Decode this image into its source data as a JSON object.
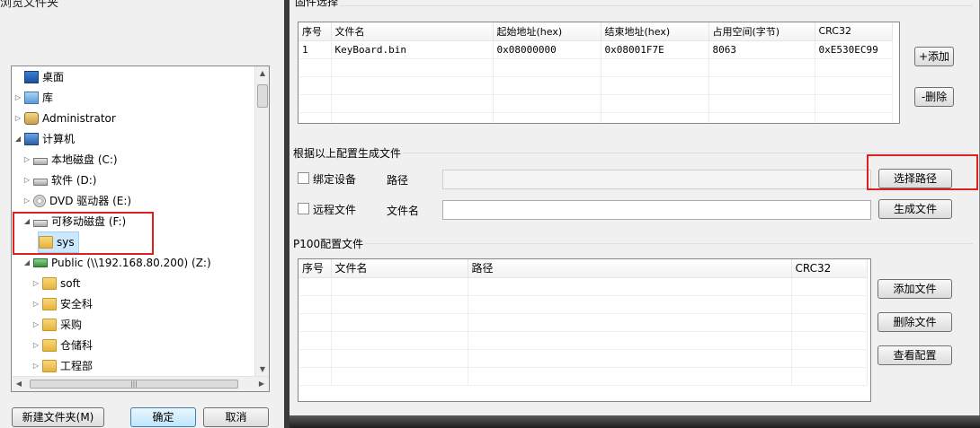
{
  "browse_dialog": {
    "title": "浏览文件夹",
    "tree": [
      {
        "label": "桌面",
        "icon": "desktop-icon"
      },
      {
        "label": "库",
        "icon": "library-icon"
      },
      {
        "label": "Administrator",
        "icon": "user-folder-icon"
      },
      {
        "label": "计算机",
        "icon": "computer-icon"
      },
      {
        "label": "本地磁盘 (C:)",
        "icon": "hard-drive-icon"
      },
      {
        "label": "软件 (D:)",
        "icon": "hard-drive-icon"
      },
      {
        "label": "DVD 驱动器 (E:)",
        "icon": "dvd-drive-icon"
      },
      {
        "label": "可移动磁盘 (F:)",
        "icon": "removable-drive-icon"
      },
      {
        "label": "sys",
        "icon": "folder-icon"
      },
      {
        "label": "Public (\\\\192.168.80.200) (Z:)",
        "icon": "network-drive-icon"
      },
      {
        "label": "soft",
        "icon": "folder-icon"
      },
      {
        "label": "安全科",
        "icon": "folder-icon"
      },
      {
        "label": "采购",
        "icon": "folder-icon"
      },
      {
        "label": "仓储科",
        "icon": "folder-icon"
      },
      {
        "label": "工程部",
        "icon": "folder-icon"
      }
    ],
    "buttons": {
      "new_folder": "新建文件夹(M)",
      "ok": "确定",
      "cancel": "取消"
    }
  },
  "firmware_section": {
    "title": "固件选择",
    "columns": [
      "序号",
      "文件名",
      "起始地址(hex)",
      "结束地址(hex)",
      "占用空间(字节)",
      "CRC32"
    ],
    "rows": [
      [
        "1",
        "KeyBoard.bin",
        "0x08000000",
        "0x08001F7E",
        "8063",
        "0xE530EC99"
      ]
    ],
    "add_button": "+添加",
    "delete_button": "-删除"
  },
  "generate_section": {
    "title": "根据以上配置生成文件",
    "bind_device_label": "绑定设备",
    "path_label": "路径",
    "path_value": "",
    "choose_path_button": "选择路径",
    "remote_file_label": "远程文件",
    "filename_label": "文件名",
    "filename_value": "",
    "generate_button": "生成文件"
  },
  "p100_section": {
    "title": "P100配置文件",
    "columns": [
      "序号",
      "文件名",
      "路径",
      "CRC32"
    ],
    "rows": [],
    "add_file_button": "添加文件",
    "delete_file_button": "删除文件",
    "view_config_button": "查看配置"
  },
  "colors": {
    "highlight_border": "#e02020",
    "selection": "#cce8ff"
  }
}
